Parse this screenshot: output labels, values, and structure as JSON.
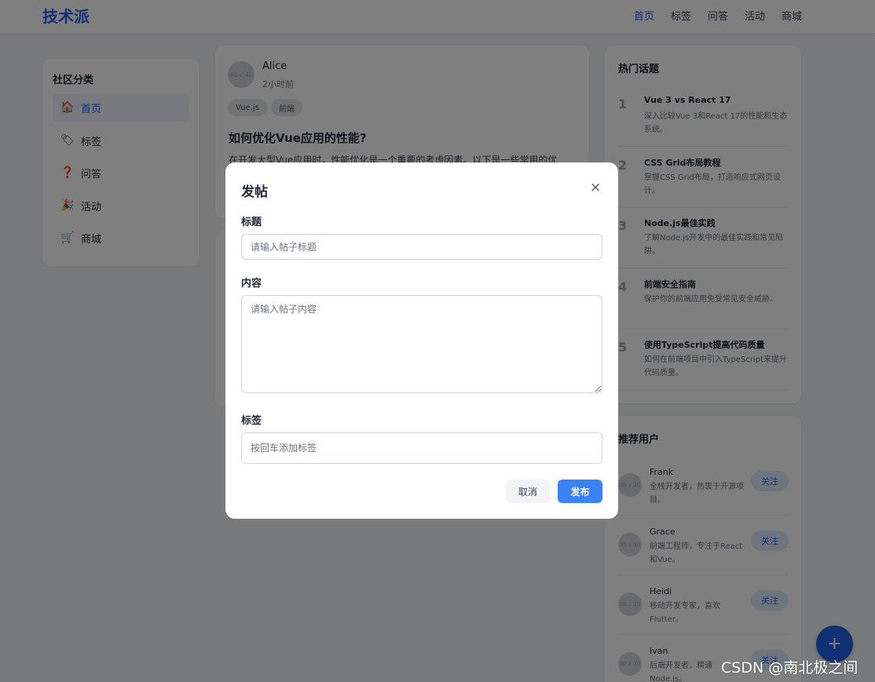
{
  "header": {
    "logo": "技术派",
    "nav": [
      "首页",
      "标签",
      "问答",
      "活动",
      "商城"
    ]
  },
  "sidebar": {
    "title": "社区分类",
    "items": [
      {
        "label": "首页",
        "icon": "home-icon",
        "glyph": "🏠"
      },
      {
        "label": "标签",
        "icon": "tag-icon",
        "glyph": "🏷"
      },
      {
        "label": "问答",
        "icon": "question-icon",
        "glyph": "❓"
      },
      {
        "label": "活动",
        "icon": "party-icon",
        "glyph": "🎉"
      },
      {
        "label": "商城",
        "icon": "cart-icon",
        "glyph": "🛒"
      }
    ]
  },
  "post": {
    "avatar": "40 x 40",
    "author": "Alice",
    "time": "2小时前",
    "tags": [
      "Vue.js",
      "前端"
    ],
    "title": "如何优化Vue应用的性能?",
    "excerpt": "在开发大型Vue应用时，性能优化是一个重要的考虑因素。以下是一些常用的优"
  },
  "hot": {
    "title": "热门话题",
    "items": [
      {
        "num": "1",
        "title": "Vue 3 vs React 17",
        "desc": "深入比较Vue 3和React 17的性能和生态系统。"
      },
      {
        "num": "2",
        "title": "CSS Grid布局教程",
        "desc": "掌握CSS Grid布局，打造响应式网页设计。"
      },
      {
        "num": "3",
        "title": "Node.js最佳实践",
        "desc": "了解Node.js开发中的最佳实践和常见陷阱。"
      },
      {
        "num": "4",
        "title": "前端安全指南",
        "desc": "保护你的前端应用免受常见安全威胁。"
      },
      {
        "num": "5",
        "title": "使用TypeScript提高代码质量",
        "desc": "如何在前端项目中引入TypeScript来提升代码质量。"
      }
    ]
  },
  "users": {
    "title": "推荐用户",
    "avatar": "30 x 30",
    "follow_label": "关注",
    "items": [
      {
        "name": "Frank",
        "bio": "全栈开发者，热衷于开源项目。"
      },
      {
        "name": "Grace",
        "bio": "前端工程师，专注于React和Vue。"
      },
      {
        "name": "Heidi",
        "bio": "移动开发专家，喜欢Flutter。"
      },
      {
        "name": "Ivan",
        "bio": "后端开发者，精通Node.js。"
      }
    ]
  },
  "fab": {
    "label": "+"
  },
  "modal": {
    "title": "发帖",
    "close": "×",
    "title_label": "标题",
    "title_placeholder": "请输入帖子标题",
    "content_label": "内容",
    "content_placeholder": "请输入帖子内容",
    "tags_label": "标签",
    "tags_placeholder": "按回车添加标签",
    "cancel": "取消",
    "submit": "发布"
  },
  "watermark": "CSDN @南北极之间",
  "colors": {
    "accent": "#2563eb",
    "button": "#3b82f6",
    "overlay": "rgba(0,0,0,0.5)"
  }
}
